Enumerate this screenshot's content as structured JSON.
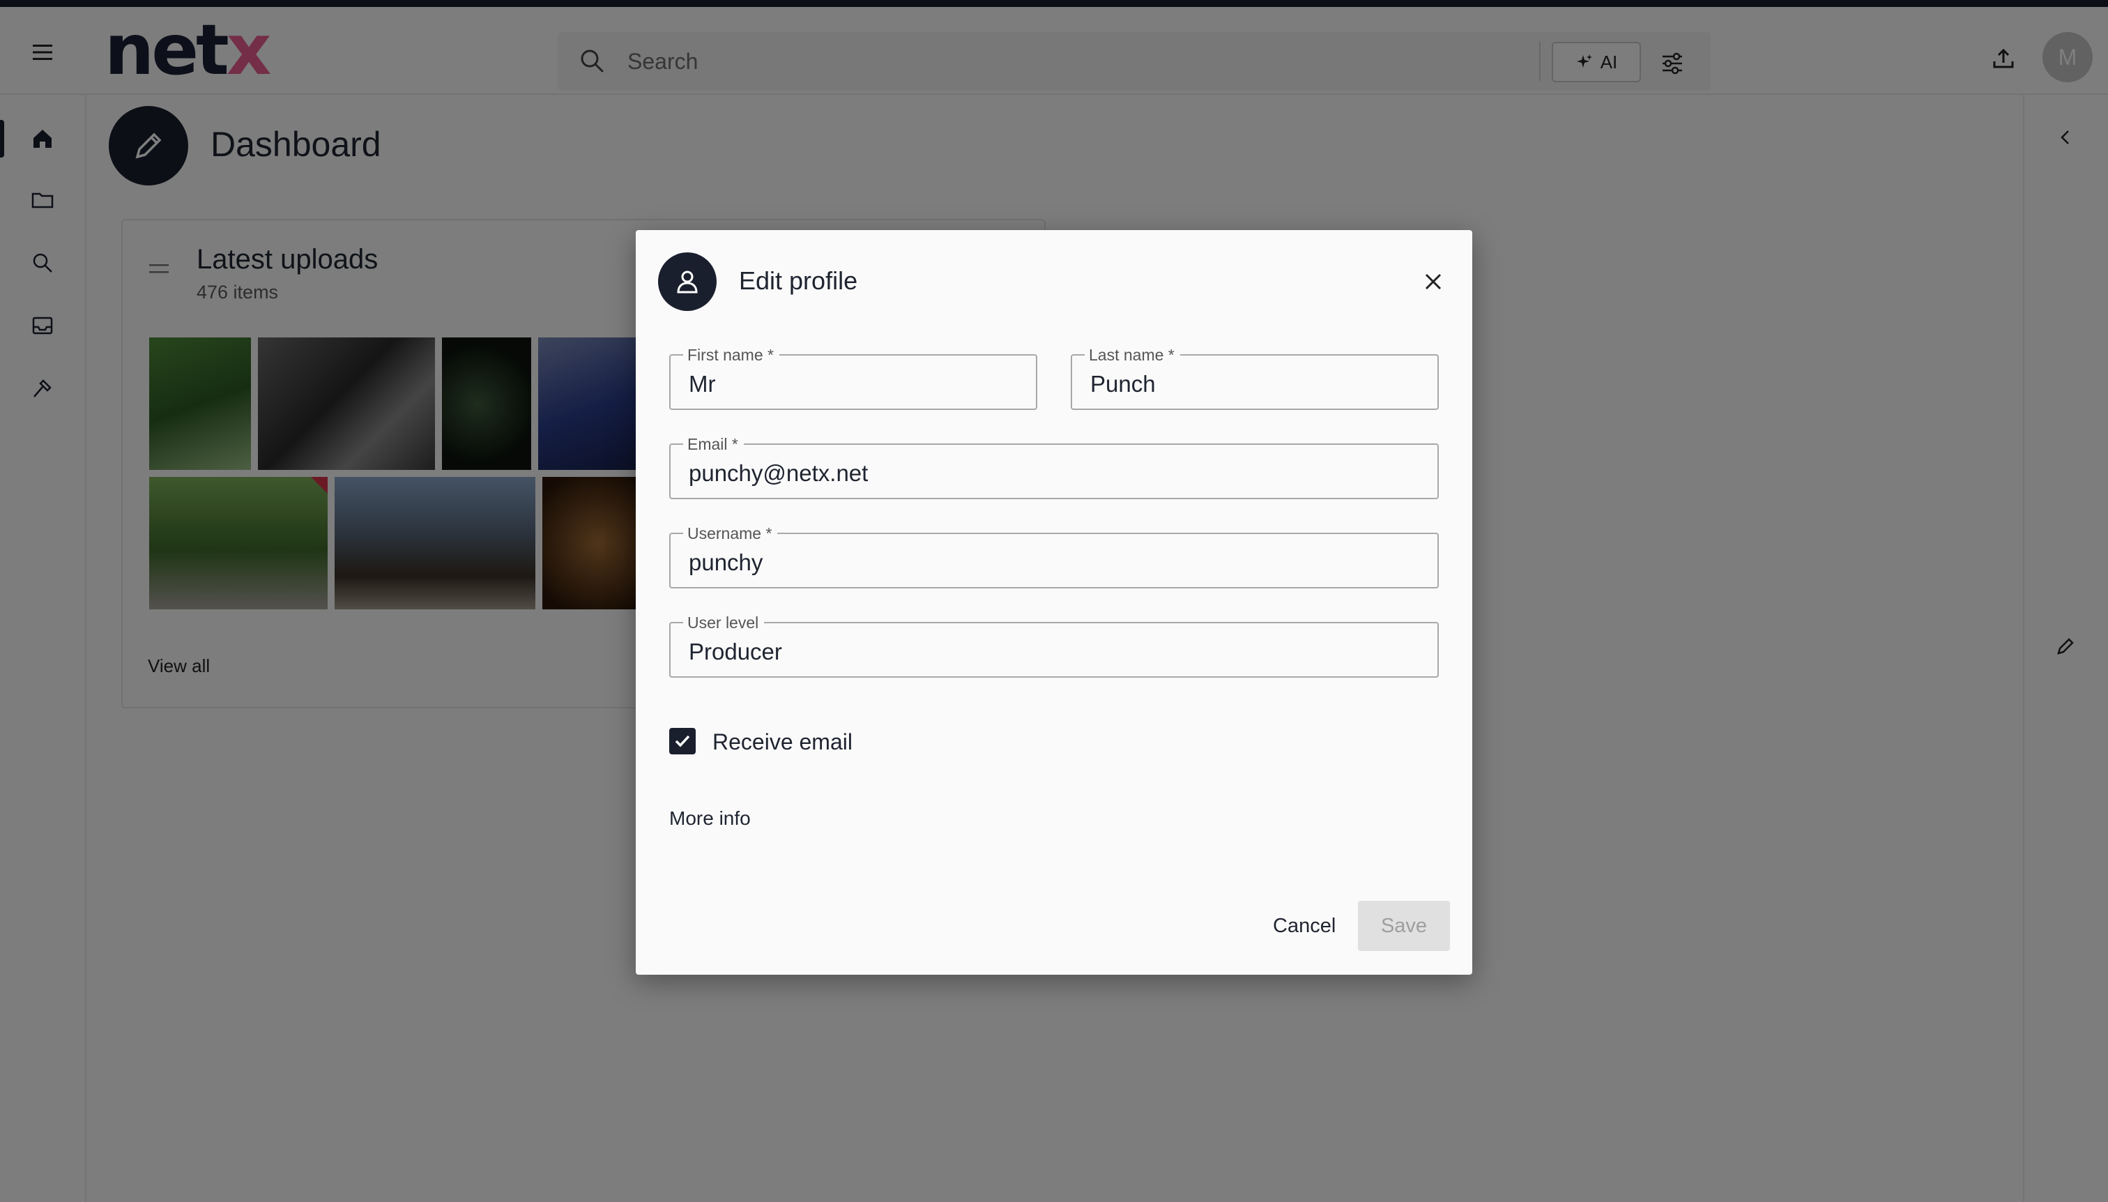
{
  "app": {
    "logo_text": "netx",
    "search_placeholder": "Search",
    "ai_label": "AI",
    "avatar_initial": "M"
  },
  "page": {
    "title": "Dashboard"
  },
  "card": {
    "title": "Latest uploads",
    "subtitle": "476 items",
    "view_all": "View all"
  },
  "dialog": {
    "title": "Edit profile",
    "fields": {
      "first_name": {
        "label": "First name *",
        "value": "Mr"
      },
      "last_name": {
        "label": "Last name *",
        "value": "Punch"
      },
      "email": {
        "label": "Email *",
        "value": "punchy@netx.net"
      },
      "username": {
        "label": "Username *",
        "value": "punchy"
      },
      "user_level": {
        "label": "User level",
        "value": "Producer"
      }
    },
    "receive_email": {
      "label": "Receive email",
      "checked": true
    },
    "more_info": "More info",
    "cancel": "Cancel",
    "save": "Save"
  },
  "icons": {
    "nav": [
      "home-icon",
      "folder-icon",
      "search-icon",
      "inbox-icon",
      "tools-icon"
    ]
  },
  "colors": {
    "primary_dark": "#1a1f2e",
    "flag_red": "#d6324a",
    "logo_pink": "#e85d8f",
    "logo_teal": "#3d9b8a"
  }
}
